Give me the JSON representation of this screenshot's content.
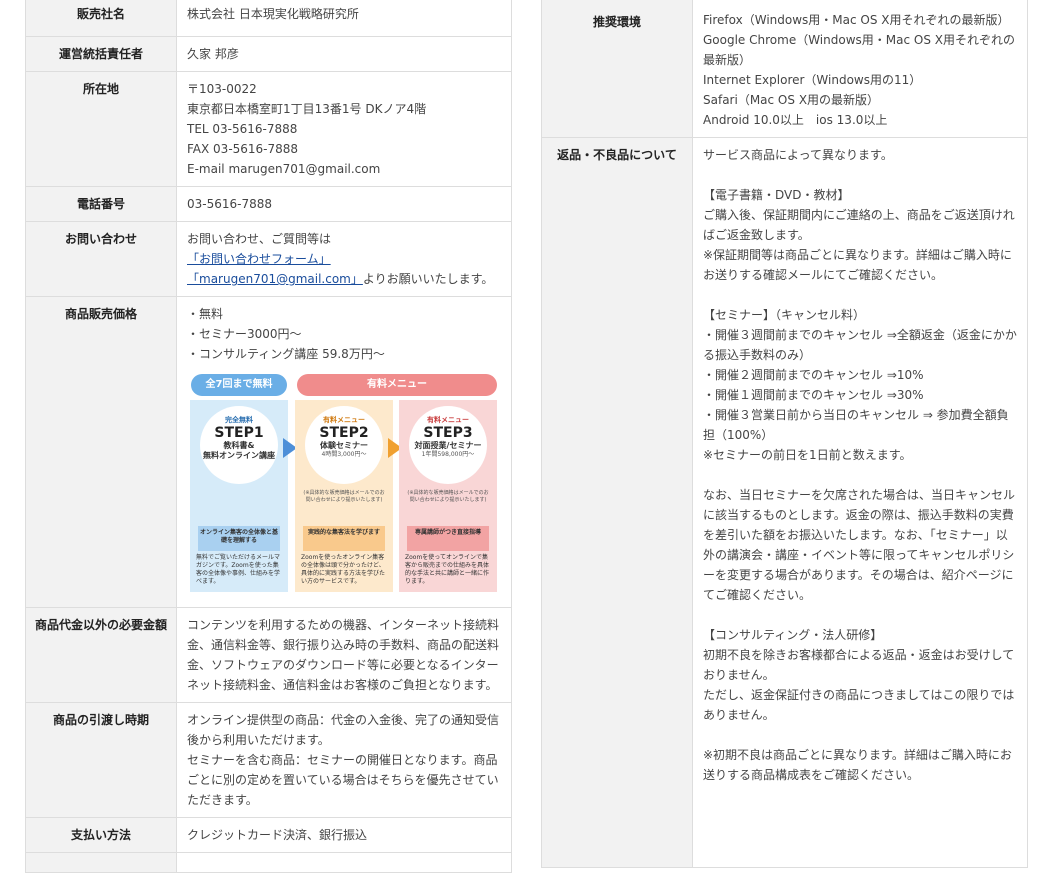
{
  "left": {
    "seller_label": "販売社名",
    "seller_value": "株式会社 日本現実化戦略研究所",
    "manager_label": "運営統括責任者",
    "manager_value": "久家 邦彦",
    "address_label": "所在地",
    "address_lines": [
      "〒103-0022",
      "東京都日本橋室町1丁目13番1号 DKノア4階",
      "TEL 03-5616-7888",
      "FAX 03-5616-7888",
      "E-mail marugen701@gmail.com"
    ],
    "phone_label": "電話番号",
    "phone_value": "03-5616-7888",
    "contact_label": "お問い合わせ",
    "contact_intro": "お問い合わせ、ご質問等は",
    "contact_link_form": "「お問い合わせフォーム」",
    "contact_link_email": "「marugen701@gmail.com」",
    "contact_tail": "よりお願いいたします。",
    "price_label": "商品販売価格",
    "price_lines": [
      "・無料",
      "・セミナー3000円～",
      "・コンサルティング講座 59.8万円～"
    ],
    "other_fee_label": "商品代金以外の必要金額",
    "other_fee_value": "コンテンツを利用するための機器、インターネット接続料金、通信料金等、銀行振り込み時の手数料、商品の配送料金、ソフトウェアのダウンロード等に必要となるインターネット接続料金、通信料金はお客様のご負担となります。",
    "delivery_label": "商品の引渡し時期",
    "delivery_line1": "オンライン提供型の商品：代金の入金後、完了の通知受信後から利用いただけます。",
    "delivery_line2": "セミナーを含む商品：セミナーの開催日となります。商品ごとに別の定めを置いている場合はそちらを優先させていただきます。",
    "payment_label": "支払い方法",
    "payment_value": "クレジットカード決済、銀行振込"
  },
  "flow": {
    "free_pill": "全7回まで無料",
    "paid_pill": "有料メニュー",
    "steps": [
      {
        "tag": "完全無料",
        "step": "STEP1",
        "sub": "教科書&",
        "desc": "無料オンライン講座",
        "box": "オンライン集客の全体像と基礎を理解する",
        "body": "無料でご覧いただけるメールマガジンです。Zoomを使った集客の全体像や事例、仕組みを学べます。",
        "note": ""
      },
      {
        "tag": "有料メニュー",
        "step": "STEP2",
        "sub": "体験セミナー",
        "desc": "4時間3,000円～",
        "box": "実践的な集客法を学びます",
        "body": "Zoomを使ったオンライン集客の全体像は頭で分かったけど、具体的に実践する方法を学びたい方のサービスです。",
        "note": "(※具体的な販売価格はメールでのお問い合わせにより提示いたします)"
      },
      {
        "tag": "有料メニュー",
        "step": "STEP3",
        "sub": "対面授業/セミナー",
        "desc": "1年間598,000円～",
        "box": "専属講師がつき直接指導",
        "body": "Zoomを使ってオンラインで集客から販売までの仕組みを具体的な手法と共に講師と一緒に作ります。",
        "note": "(※具体的な販売価格はメールでのお問い合わせにより提示いたします)"
      }
    ]
  },
  "right": {
    "env_label": "推奨環境",
    "env_lines": [
      "Firefox（Windows用・Mac OS X用それぞれの最新版）",
      "Google Chrome（Windows用・Mac OS X用それぞれの最新版）",
      "Internet Explorer（Windows用の11）",
      "Safari（Mac OS X用の最新版）",
      "Android 10.0以上　ios 13.0以上"
    ],
    "return_label": "返品・不良品について",
    "r_intro": "サービス商品によって異なります。",
    "r_ebook_head": "【電子書籍・DVD・教材】",
    "r_ebook_1": "ご購入後、保証期間内にご連絡の上、商品をご返送頂ければご返金致します。",
    "r_ebook_2": "※保証期間等は商品ごとに異なります。詳細はご購入時にお送りする確認メールにてご確認ください。",
    "r_seminar_head": "【セミナー】（キャンセル料）",
    "r_seminar_1": "・開催３週間前までのキャンセル ⇒全額返金（返金にかかる振込手数料のみ）",
    "r_seminar_2": "・開催２週間前までのキャンセル ⇒10%",
    "r_seminar_3": "・開催１週間前までのキャンセル ⇒30%",
    "r_seminar_4": "・開催３営業日前から当日のキャンセル ⇒ 参加費全額負担（100%）",
    "r_seminar_5": "※セミナーの前日を1日前と数えます。",
    "r_absence": "なお、当日セミナーを欠席された場合は、当日キャンセルに該当するものとします。返金の際は、振込手数料の実費を差引いた額をお振込いたします。なお、「セミナー」以外の講演会・講座・イベント等に限ってキャンセルポリシーを変更する場合があります。その場合は、紹介ページにてご確認ください。",
    "r_consult_head": "【コンサルティング・法人研修】",
    "r_consult_1": "初期不良を除きお客様都合による返品・返金はお受けしておりません。",
    "r_consult_2": "ただし、返金保証付きの商品につきましてはこの限りではありません。",
    "r_note": "※初期不良は商品ごとに異なります。詳細はご購入時にお送りする商品構成表をご確認ください。"
  }
}
